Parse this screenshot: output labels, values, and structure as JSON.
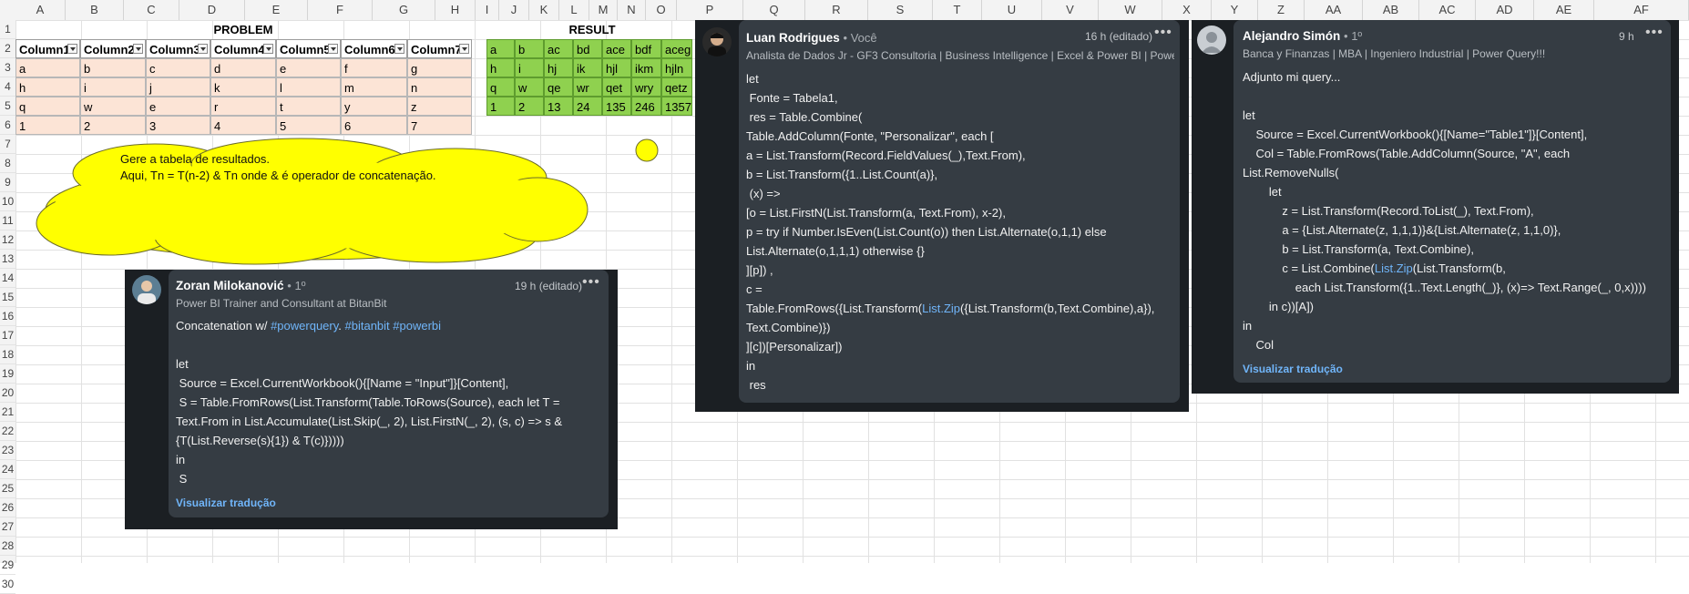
{
  "columns": [
    "A",
    "B",
    "C",
    "D",
    "E",
    "F",
    "G",
    "H",
    "I",
    "J",
    "K",
    "L",
    "M",
    "N",
    "O",
    "P",
    "Q",
    "R",
    "S",
    "T",
    "U",
    "V",
    "W",
    "X",
    "Y",
    "Z",
    "AA",
    "AB",
    "AC",
    "AD",
    "AE",
    "AF"
  ],
  "rows": [
    "1",
    "2",
    "3",
    "4",
    "5",
    "6",
    "7",
    "8",
    "9",
    "10",
    "11",
    "12",
    "13",
    "14",
    "15",
    "16",
    "17",
    "18",
    "19",
    "20",
    "21",
    "22",
    "23",
    "24",
    "25",
    "26",
    "27",
    "28",
    "29",
    "30"
  ],
  "problem": {
    "title": "PROBLEM",
    "headers": [
      "Column1",
      "Column2",
      "Column3",
      "Column4",
      "Column5",
      "Column6",
      "Column7"
    ],
    "rows": [
      [
        "a",
        "b",
        "c",
        "d",
        "e",
        "f",
        "g"
      ],
      [
        "h",
        "i",
        "j",
        "k",
        "l",
        "m",
        "n"
      ],
      [
        "q",
        "w",
        "e",
        "r",
        "t",
        "y",
        "z"
      ],
      [
        "1",
        "2",
        "3",
        "4",
        "5",
        "6",
        "7"
      ]
    ]
  },
  "result": {
    "title": "RESULT",
    "rows": [
      [
        "a",
        "b",
        "ac",
        "bd",
        "ace",
        "bdf",
        "aceg"
      ],
      [
        "h",
        "i",
        "hj",
        "ik",
        "hjl",
        "ikm",
        "hjln"
      ],
      [
        "q",
        "w",
        "qe",
        "wr",
        "qet",
        "wry",
        "qetz"
      ],
      [
        "1",
        "2",
        "13",
        "24",
        "135",
        "246",
        "1357"
      ]
    ]
  },
  "cloud": {
    "line1": "Gere a tabela de resultados.",
    "line2": "Aqui, Tn = T(n-2) & Tn onde & é operador de concatenação."
  },
  "colors": {
    "cloud": "#ffff00",
    "problem_fill": "#fce4d6",
    "result_fill": "#8fd14f",
    "card_bg": "#353c43",
    "link": "#70b5f9"
  },
  "comments": {
    "zoran": {
      "name": "Zoran Milokanović",
      "degree": "• 1º",
      "subtitle": "Power BI Trainer and Consultant at BitanBit",
      "time": "19 h (editado)",
      "menu": "•••",
      "translate": "Visualizar tradução",
      "intro_text": "Concatenation w/ ",
      "tag1": "#powerquery",
      "sep": ". ",
      "tag2": "#bitanbit",
      "space": " ",
      "tag3": "#powerbi",
      "code": [
        "let",
        " Source = Excel.CurrentWorkbook(){[Name = \"Input\"]}[Content],",
        " S = Table.FromRows(List.Transform(Table.ToRows(Source), each let T =",
        "Text.From in List.Accumulate(List.Skip(_, 2), List.FirstN(_, 2), (s, c) => s &",
        "{T(List.Reverse(s){1}) & T(c)}))))",
        "in",
        " S"
      ]
    },
    "luan": {
      "name": "Luan Rodrigues",
      "degree": "• Você",
      "subtitle": "Analista de Dados Jr - GF3 Consultoria | Business Intelligence | Excel & Power BI | Powe...",
      "time": "16 h (editado)",
      "menu": "•••",
      "code_before": [
        "let",
        " Fonte = Tabela1,",
        " res = Table.Combine(",
        "Table.AddColumn(Fonte, \"Personalizar\", each [",
        "a = List.Transform(Record.FieldValues(_),Text.From),",
        "b = List.Transform({1..List.Count(a)},",
        " (x) =>",
        "[o = List.FirstN(List.Transform(a, Text.From), x-2),",
        "p = try if Number.IsEven(List.Count(o)) then List.Alternate(o,1,1) else",
        "List.Alternate(o,1,1,1) otherwise {}",
        "][p]) ,",
        "c ="
      ],
      "zip_pre": "Table.FromRows({List.Transform(",
      "zip": "List.Zip",
      "zip_post": "({List.Transform(b,Text.Combine),a}),",
      "code_after": [
        "Text.Combine)})",
        "][c])[Personalizar])",
        "in",
        " res"
      ]
    },
    "alejandro": {
      "name": "Alejandro Simón",
      "degree": "• 1º",
      "subtitle": "Banca y Finanzas | MBA | Ingeniero Industrial | Power Query!!!",
      "time": "9 h",
      "menu": "•••",
      "translate": "Visualizar tradução",
      "code_before": [
        "Adjunto mi query...",
        "",
        "let",
        "    Source = Excel.CurrentWorkbook(){[Name=\"Table1\"]}[Content],",
        "    Col = Table.FromRows(Table.AddColumn(Source, \"A\", each",
        "List.RemoveNulls(",
        "        let",
        "            z = List.Transform(Record.ToList(_), Text.From),",
        "            a = {List.Alternate(z, 1,1,1)}&{List.Alternate(z, 1,1,0)},",
        "            b = List.Transform(a, Text.Combine),"
      ],
      "zip_pre": "            c = List.Combine(",
      "zip": "List.Zip",
      "zip_post": "(List.Transform(b,",
      "code_after": [
        "                each List.Transform({1..Text.Length(_)}, (x)=> Text.Range(_, 0,x))))",
        "        in c))[A])",
        "in",
        "    Col"
      ]
    }
  }
}
